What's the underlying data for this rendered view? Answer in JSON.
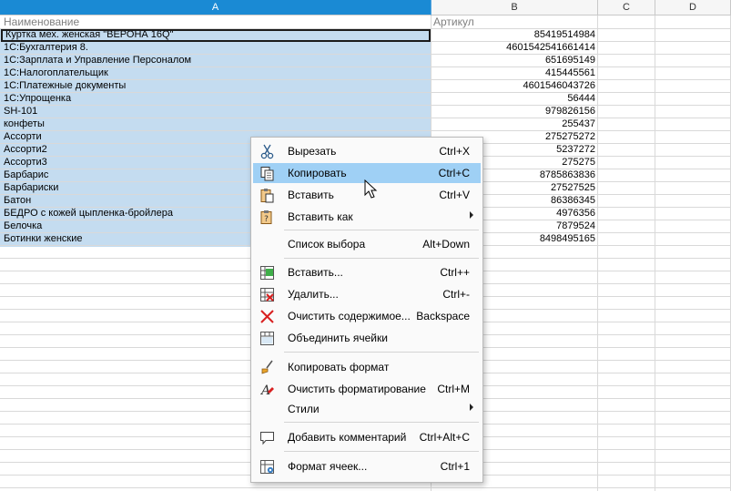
{
  "columns": [
    "A",
    "B",
    "C",
    "D"
  ],
  "header_row": {
    "a": "Наименование",
    "b": "Артикул"
  },
  "rows": [
    {
      "a": "Куртка мех. женская \"ВЕРОНА 16Q\"",
      "b": "85419514984"
    },
    {
      "a": "1С:Бухгалтерия 8.",
      "b": "4601542541661414"
    },
    {
      "a": "1С:Зарплата и Управление Персоналом",
      "b": "651695149"
    },
    {
      "a": "1С:Налогоплательщик",
      "b": "415445561"
    },
    {
      "a": "1С:Платежные документы",
      "b": "4601546043726"
    },
    {
      "a": "1С:Упрощенка",
      "b": "56444"
    },
    {
      "a": "SH-101",
      "b": "979826156"
    },
    {
      "a": "конфеты",
      "b": "255437"
    },
    {
      "a": "Ассорти",
      "b": "275275272"
    },
    {
      "a": "Ассорти2",
      "b": "5237272"
    },
    {
      "a": "Ассорти3",
      "b": "275275"
    },
    {
      "a": "Барбарис",
      "b": "8785863836"
    },
    {
      "a": "Барбариски",
      "b": "27527525"
    },
    {
      "a": "Батон",
      "b": "86386345"
    },
    {
      "a": "БЕДРО с кожей цыпленка-бройлера",
      "b": "4976356"
    },
    {
      "a": "Белочка",
      "b": "7879524"
    },
    {
      "a": "Ботинки женские",
      "b": "8498495165"
    }
  ],
  "context_menu": {
    "cut": {
      "label": "Вырезать",
      "shortcut": "Ctrl+X"
    },
    "copy": {
      "label": "Копировать",
      "shortcut": "Ctrl+C"
    },
    "paste": {
      "label": "Вставить",
      "shortcut": "Ctrl+V"
    },
    "paste_special": {
      "label": "Вставить как"
    },
    "selection_list": {
      "label": "Список выбора",
      "shortcut": "Alt+Down"
    },
    "insert": {
      "label": "Вставить...",
      "shortcut": "Ctrl++"
    },
    "delete": {
      "label": "Удалить...",
      "shortcut": "Ctrl+-"
    },
    "clear_contents": {
      "label": "Очистить содержимое...",
      "shortcut": "Backspace"
    },
    "merge_cells": {
      "label": "Объединить ячейки"
    },
    "clone_format": {
      "label": "Копировать формат"
    },
    "clear_formatting": {
      "label": "Очистить форматирование",
      "shortcut": "Ctrl+M"
    },
    "styles": {
      "label": "Стили"
    },
    "add_comment": {
      "label": "Добавить комментарий",
      "shortcut": "Ctrl+Alt+C"
    },
    "format_cells": {
      "label": "Формат ячеек...",
      "shortcut": "Ctrl+1"
    }
  },
  "colors": {
    "selection_header": "#1a8ad4",
    "selection_fill": "#c4dcf0",
    "menu_highlight": "#9fd0f5",
    "delete_red": "#d82020"
  }
}
